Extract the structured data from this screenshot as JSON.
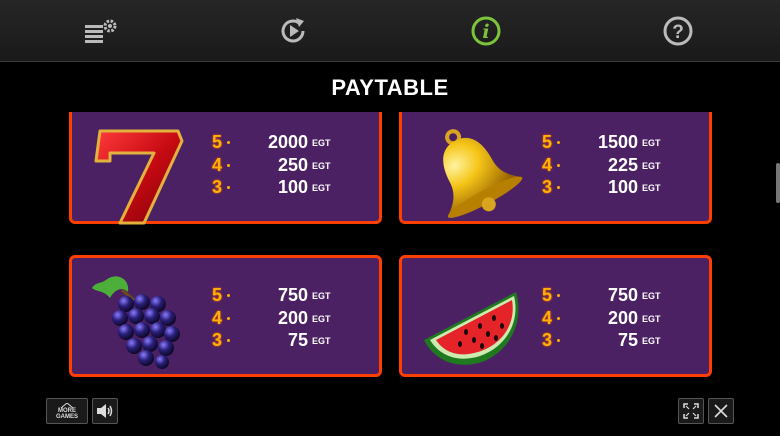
{
  "header": {
    "title": "PAYTABLE",
    "icons": [
      "settings-stack-icon",
      "autoplay-icon",
      "info-icon",
      "help-icon"
    ],
    "active_color": "#7cc43b"
  },
  "panels": [
    {
      "symbol": "seven",
      "payouts": [
        {
          "count": "5",
          "amount": "2000",
          "unit": "EGT"
        },
        {
          "count": "4",
          "amount": "250",
          "unit": "EGT"
        },
        {
          "count": "3",
          "amount": "100",
          "unit": "EGT"
        }
      ]
    },
    {
      "symbol": "bell",
      "payouts": [
        {
          "count": "5",
          "amount": "1500",
          "unit": "EGT"
        },
        {
          "count": "4",
          "amount": "225",
          "unit": "EGT"
        },
        {
          "count": "3",
          "amount": "100",
          "unit": "EGT"
        }
      ]
    },
    {
      "symbol": "grapes",
      "payouts": [
        {
          "count": "5",
          "amount": "750",
          "unit": "EGT"
        },
        {
          "count": "4",
          "amount": "200",
          "unit": "EGT"
        },
        {
          "count": "3",
          "amount": "75",
          "unit": "EGT"
        }
      ]
    },
    {
      "symbol": "watermelon",
      "payouts": [
        {
          "count": "5",
          "amount": "750",
          "unit": "EGT"
        },
        {
          "count": "4",
          "amount": "200",
          "unit": "EGT"
        },
        {
          "count": "3",
          "amount": "75",
          "unit": "EGT"
        }
      ]
    }
  ],
  "footer": {
    "more_games_line1": "MORE",
    "more_games_line2": "GAMES",
    "icons": [
      "sound-icon",
      "fullscreen-icon",
      "close-icon"
    ]
  },
  "colors": {
    "panel_bg": "#4b2163",
    "panel_border": "#ff3f00",
    "count": "#ffb000"
  }
}
